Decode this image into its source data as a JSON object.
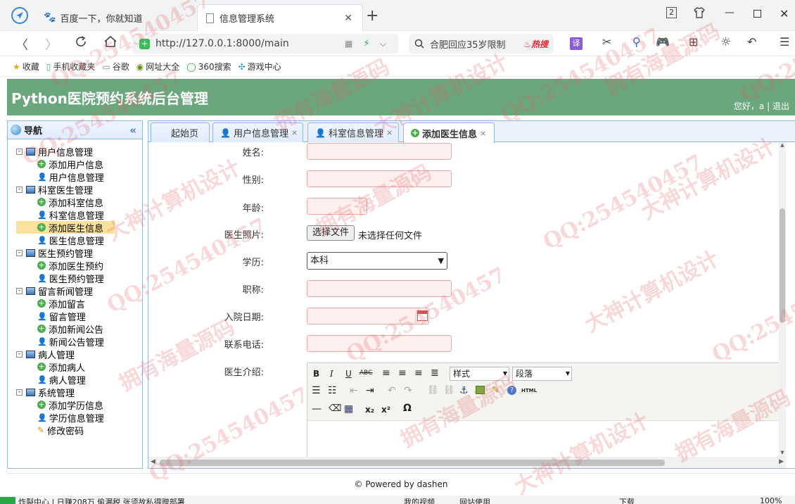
{
  "browser": {
    "tabs": [
      {
        "label": "百度一下，你就知道"
      },
      {
        "label": "信息管理系统"
      }
    ],
    "window_badge": "2",
    "url": "http://127.0.0.1:8000/main",
    "search_text": "合肥回应35岁限制",
    "hot_label": "热搜",
    "bookmarks": [
      "收藏",
      "手机收藏夹",
      "谷歌",
      "网址大全",
      "360搜索",
      "游戏中心"
    ]
  },
  "header": {
    "title": "Python医院预约系统后台管理",
    "greeting": "您好，a",
    "logout": "退出"
  },
  "sidebar": {
    "title": "导航",
    "groups": [
      {
        "label": "用户信息管理",
        "items": [
          "添加用户信息",
          "用户信息管理"
        ]
      },
      {
        "label": "科室医生管理",
        "items": [
          "添加科室信息",
          "科室信息管理",
          "添加医生信息",
          "医生信息管理"
        ]
      },
      {
        "label": "医生预约管理",
        "items": [
          "添加医生预约",
          "医生预约管理"
        ]
      },
      {
        "label": "留言新闻管理",
        "items": [
          "添加留言",
          "留言管理",
          "添加新闻公告",
          "新闻公告管理"
        ]
      },
      {
        "label": "病人管理",
        "items": [
          "添加病人",
          "病人管理"
        ]
      },
      {
        "label": "系统管理",
        "items": [
          "添加学历信息",
          "学历信息管理",
          "修改密码"
        ]
      }
    ],
    "selected": "添加医生信息"
  },
  "tabs": [
    {
      "label": "起始页",
      "closable": false
    },
    {
      "label": "用户信息管理",
      "closable": true
    },
    {
      "label": "科室信息管理",
      "closable": true
    },
    {
      "label": "添加医生信息",
      "closable": true,
      "active": true
    }
  ],
  "form": {
    "name_label": "姓名:",
    "gender_label": "性别:",
    "age_label": "年龄:",
    "photo_label": "医生照片:",
    "file_button": "选择文件",
    "file_status": "未选择任何文件",
    "education_label": "学历:",
    "education_value": "本科",
    "title_label": "职称:",
    "date_label": "入院日期:",
    "phone_label": "联系电话:",
    "intro_label": "医生介绍:",
    "editor": {
      "style_select": "样式",
      "paragraph_select": "段落",
      "html_label": "HTML"
    }
  },
  "footer": {
    "text": "© Powered by dashen"
  },
  "status_bar": {
    "left": "炸裂中心 | 日赚208万 偷漏税 张须故私得赠部署",
    "video": "我的视频",
    "web": "网站使用",
    "download": "下载",
    "zoom": "100%"
  },
  "watermarks": [
    "QQ:254540457",
    "拥有海量源码",
    "大神计算机设计"
  ],
  "colors": {
    "header_bg": "#6aa77c",
    "panel_border": "#95b8e7",
    "selected_bg": "#fbe29c",
    "input_border": "#f3a7a7",
    "input_bg": "#fff0f0"
  }
}
